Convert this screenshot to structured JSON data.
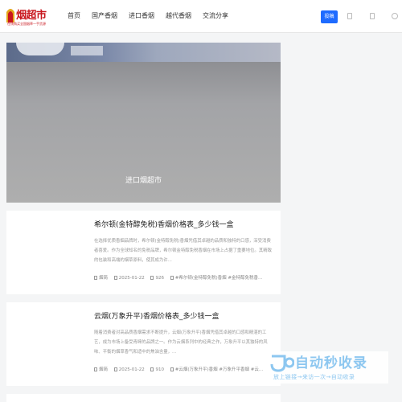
{
  "header": {
    "logo_text": "烟超市",
    "logo_tagline": "在线购买全国烟草一手货源",
    "nav": [
      "首页",
      "国产香烟",
      "进口香烟",
      "越代香烟",
      "交流分享"
    ],
    "post_label": "投稿",
    "brand_color": "#c8161d",
    "accent_color": "#1e6bff"
  },
  "banner": {
    "caption": "进口烟超市"
  },
  "articles": [
    {
      "title": "希尔顿(金特醇免税)香烟价格表_多少钱一盒",
      "desc": "在选择优质香烟品牌时，希尔顿(金特醇免税)香烟凭借其卓越的品质和独特的口感，深受消费者喜爱。作为全球知名的免税品牌，希尔顿金特醇免税香烟在市场上占据了重要地位。其精致的包装和高端的烟草原料，使其成为许...",
      "author": "烟简",
      "date": "2025-01-22",
      "views": "926",
      "tags": "#希尔顿(金特醇免税)香烟 #金特醇免税香..."
    },
    {
      "title": "云烟(万象升平)香烟价格表_多少钱一盒",
      "desc": "随着消费者对高品质香烟需求不断提升，云烟(万象升平)香烟凭借其卓越的口感和精湛的工艺，成为市场上备受青睐的品牌之一。作为云烟系列中的经典之作，万象升平以其独特的风味、平衡的烟草香气和适中的焦油含量，...",
      "author": "烟简",
      "date": "2025-01-22",
      "views": "910",
      "tags": "#云烟(万象升平)香烟 #万象升平香烟 #云..."
    }
  ],
  "watermark": {
    "title": "自动秒收录",
    "subtitle": "放上链接→来访一次→自动收录"
  }
}
